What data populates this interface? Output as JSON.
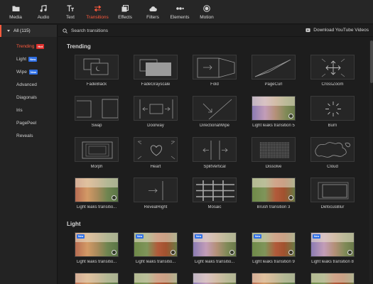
{
  "toolbar": {
    "items": [
      {
        "label": "Media",
        "icon": "folder-icon"
      },
      {
        "label": "Audio",
        "icon": "music-note-icon"
      },
      {
        "label": "Text",
        "icon": "text-icon"
      },
      {
        "label": "Transitions",
        "icon": "transitions-icon"
      },
      {
        "label": "Effects",
        "icon": "effects-icon"
      },
      {
        "label": "Filters",
        "icon": "cloud-icon"
      },
      {
        "label": "Elements",
        "icon": "elements-icon"
      },
      {
        "label": "Motion",
        "icon": "motion-icon"
      }
    ],
    "active": "Transitions",
    "accent": "#ff5a3d"
  },
  "sidebar": {
    "all_label": "All (115)",
    "items": [
      {
        "label": "Trending",
        "tag": "Hot"
      },
      {
        "label": "Light",
        "tag": "New"
      },
      {
        "label": "Wipe",
        "tag": "New"
      },
      {
        "label": "Advanced",
        "tag": ""
      },
      {
        "label": "Diagonals",
        "tag": ""
      },
      {
        "label": "Iris",
        "tag": ""
      },
      {
        "label": "PagePeel",
        "tag": ""
      },
      {
        "label": "Reveals",
        "tag": ""
      }
    ]
  },
  "search": {
    "placeholder": "Search transitions"
  },
  "download_label": "Download YouTube Videos",
  "sections": {
    "trending": "Trending",
    "light": "Light"
  },
  "trending_tiles": [
    {
      "label": "FadeBlack"
    },
    {
      "label": "FadeGrayscale"
    },
    {
      "label": "Fold"
    },
    {
      "label": "PageCurl"
    },
    {
      "label": "CrossZoom"
    },
    {
      "label": "Swap"
    },
    {
      "label": "Doorway"
    },
    {
      "label": "DirectionalWipe"
    },
    {
      "label": "Light leaks transition 5"
    },
    {
      "label": "Burn"
    },
    {
      "label": "Morph"
    },
    {
      "label": "Heart"
    },
    {
      "label": "SplitVertical"
    },
    {
      "label": "Dissolve"
    },
    {
      "label": "Cloud"
    },
    {
      "label": "Light leaks transitio..."
    },
    {
      "label": "RevealRight"
    },
    {
      "label": "Mosaic"
    },
    {
      "label": "Brush transition 3"
    },
    {
      "label": "DefocusBlur"
    }
  ],
  "light_tiles": [
    {
      "label": "Light leaks transitio..."
    },
    {
      "label": "Light leaks transitio..."
    },
    {
      "label": "Light leaks transitio..."
    },
    {
      "label": "Light leaks transition 9"
    },
    {
      "label": "Light leaks transition 8"
    }
  ],
  "badge_new": "New"
}
